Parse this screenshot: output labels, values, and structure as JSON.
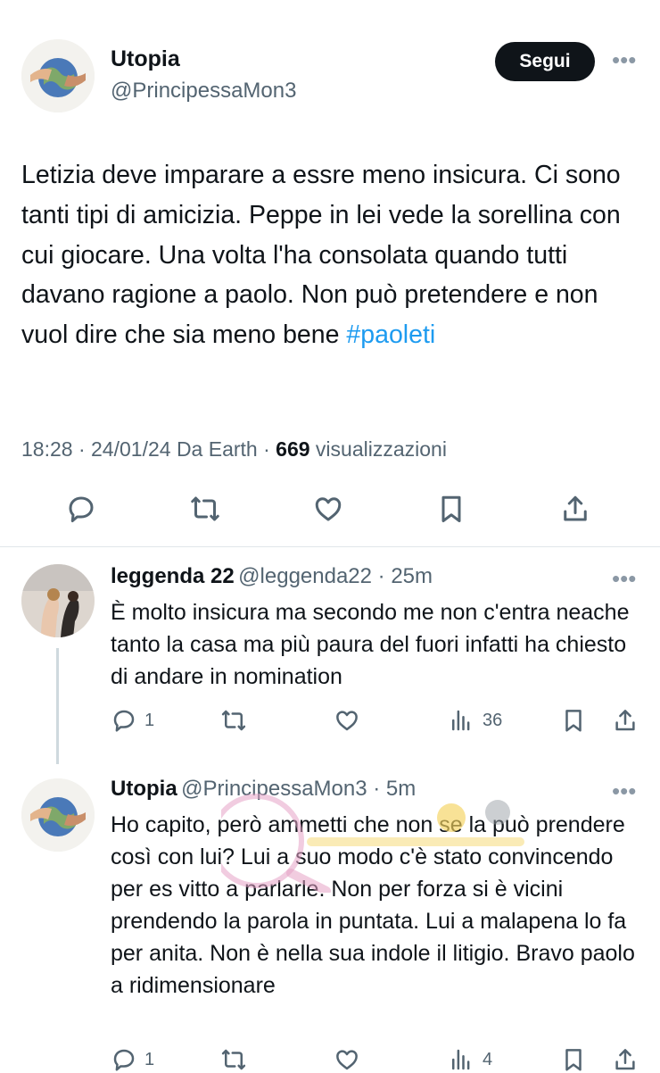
{
  "main_tweet": {
    "display_name": "Utopia",
    "handle": "@PrincipessaMon3",
    "follow_label": "Segui",
    "text_before_hashtag": "Letizia deve imparare a essre meno insicura. Ci sono tanti tipi di amicizia. Peppe in lei vede la sorellina con cui giocare. Una volta l'ha consolata quando tutti davano ragione a paolo. Non può pretendere e non vuol dire che sia meno bene ",
    "hashtag": "#paoleti",
    "time": "18:28",
    "date": "24/01/24",
    "source": "Da Earth",
    "views_count": "669",
    "views_label": "visualizzazioni",
    "icons": [
      "more-dots-icon",
      "reply-icon",
      "retweet-icon",
      "like-icon",
      "bookmark-icon",
      "share-icon"
    ]
  },
  "replies": [
    {
      "display_name": "leggenda 22",
      "handle": "@leggenda22",
      "time": "25m",
      "text": "È molto insicura ma secondo me non c'entra neache tanto la casa ma più paura del fuori infatti ha chiesto di andare in nomination",
      "reply_count": "1",
      "views_count": "36"
    },
    {
      "display_name": "Utopia",
      "handle": "@PrincipessaMon3",
      "time": "5m",
      "text": "Ho capito, però ammetti che non se la può prendere così con lui? Lui a suo modo c'è stato convincendo per es vitto a parlarle. Non per forza si è vicini prendendo la parola in puntata. Lui a malapena lo fa per anita. Non è nella sua indole il litigio. Bravo paolo a ridimensionare",
      "reply_count": "1",
      "views_count": "4"
    }
  ],
  "colors": {
    "text": "#0f1419",
    "secondary": "#536471",
    "link": "#1d9bf0",
    "button_bg": "#0f1419",
    "divider": "#e1e6ea"
  }
}
